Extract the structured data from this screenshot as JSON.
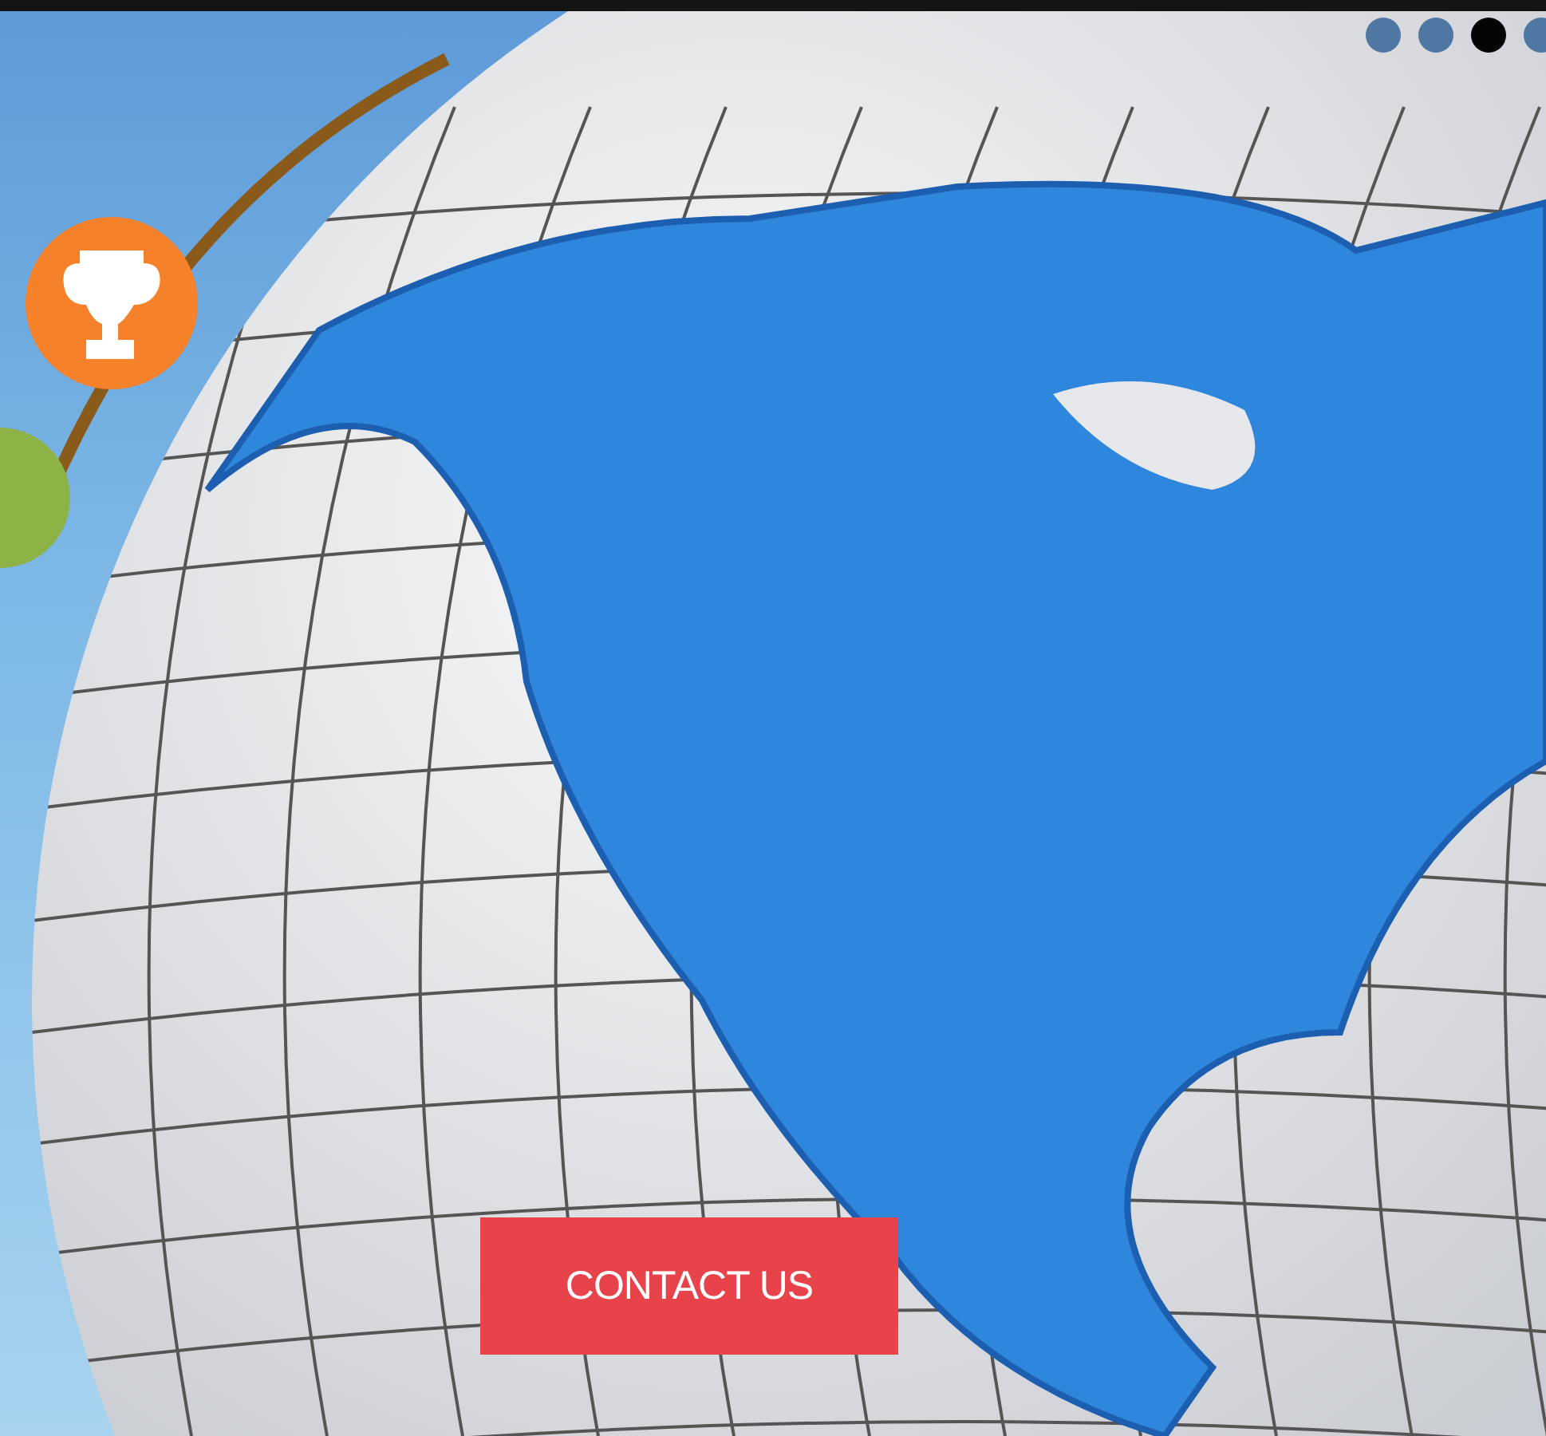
{
  "slider": {
    "dots": [
      {
        "selected": false
      },
      {
        "selected": false
      },
      {
        "selected": true
      },
      {
        "selected": false
      }
    ],
    "cta": {
      "label": "CONTACT US"
    }
  }
}
